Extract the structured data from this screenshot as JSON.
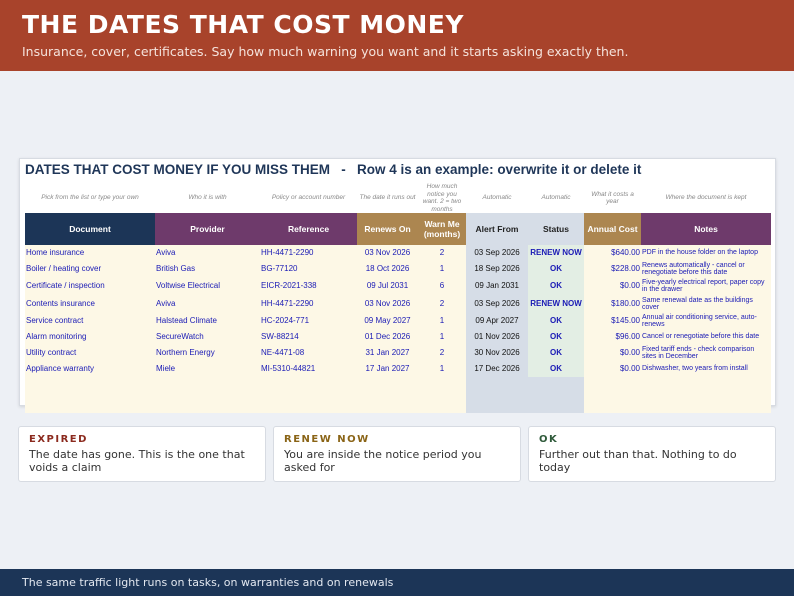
{
  "banner": {
    "title": "THE DATES THAT COST MONEY",
    "subtitle": "Insurance, cover, certificates. Say how much warning you want and it starts asking exactly then."
  },
  "sheet": {
    "title": "DATES THAT COST MONEY IF YOU MISS THEM   -   Row 4 is an example: overwrite it or delete it",
    "hints": {
      "document": "Pick from the list or type your own",
      "provider": "Who it is with",
      "reference": "Policy or account number",
      "renews_on": "The date it runs out",
      "warn_me": "How much notice you want. 2 = two months",
      "alert_from": "Automatic",
      "status": "Automatic",
      "annual_cost": "What it costs a year",
      "notes": "Where the document is kept"
    },
    "headers": {
      "document": "Document",
      "provider": "Provider",
      "reference": "Reference",
      "renews_on": "Renews On",
      "warn_me_line1": "Warn Me",
      "warn_me_line2": "(months)",
      "alert_from": "Alert From",
      "status": "Status",
      "annual_cost": "Annual Cost",
      "notes": "Notes"
    },
    "rows": [
      {
        "document": "Home insurance",
        "provider": "Aviva",
        "reference": "HH-4471-2290",
        "renews_on": "03 Nov 2026",
        "warn_me": "2",
        "alert_from": "03 Sep 2026",
        "status": "RENEW NOW",
        "annual_cost": "$640.00",
        "notes": "PDF in the house folder on the laptop"
      },
      {
        "document": "Boiler / heating cover",
        "provider": "British Gas",
        "reference": "BG-77120",
        "renews_on": "18 Oct 2026",
        "warn_me": "1",
        "alert_from": "18 Sep 2026",
        "status": "OK",
        "annual_cost": "$228.00",
        "notes": "Renews automatically - cancel or renegotiate before this date"
      },
      {
        "document": "Certificate / inspection",
        "provider": "Voltwise Electrical",
        "reference": "EICR-2021-338",
        "renews_on": "09 Jul 2031",
        "warn_me": "6",
        "alert_from": "09 Jan 2031",
        "status": "OK",
        "annual_cost": "$0.00",
        "notes": "Five-yearly electrical report, paper copy in the drawer"
      },
      {
        "document": "Contents insurance",
        "provider": "Aviva",
        "reference": "HH-4471-2290",
        "renews_on": "03 Nov 2026",
        "warn_me": "2",
        "alert_from": "03 Sep 2026",
        "status": "RENEW NOW",
        "annual_cost": "$180.00",
        "notes": "Same renewal date as the buildings cover"
      },
      {
        "document": "Service contract",
        "provider": "Halstead Climate",
        "reference": "HC-2024-771",
        "renews_on": "09 May 2027",
        "warn_me": "1",
        "alert_from": "09 Apr 2027",
        "status": "OK",
        "annual_cost": "$145.00",
        "notes": "Annual air conditioning service, auto-renews"
      },
      {
        "document": "Alarm monitoring",
        "provider": "SecureWatch",
        "reference": "SW-88214",
        "renews_on": "01 Dec 2026",
        "warn_me": "1",
        "alert_from": "01 Nov 2026",
        "status": "OK",
        "annual_cost": "$96.00",
        "notes": "Cancel or renegotiate before this date"
      },
      {
        "document": "Utility contract",
        "provider": "Northern Energy",
        "reference": "NE-4471-08",
        "renews_on": "31 Jan 2027",
        "warn_me": "2",
        "alert_from": "30 Nov 2026",
        "status": "OK",
        "annual_cost": "$0.00",
        "notes": "Fixed tariff ends - check comparison sites in December"
      },
      {
        "document": "Appliance warranty",
        "provider": "Miele",
        "reference": "MI-5310-44821",
        "renews_on": "17 Jan 2027",
        "warn_me": "1",
        "alert_from": "17 Dec 2026",
        "status": "OK",
        "annual_cost": "$0.00",
        "notes": "Dishwasher, two years from install"
      }
    ]
  },
  "legend": {
    "expired": {
      "label": "EXPIRED",
      "desc": "The date has gone. This is the one that voids a claim",
      "color": "#8b2a1e"
    },
    "renew_now": {
      "label": "RENEW NOW",
      "desc": "You are inside the notice period you asked for",
      "color": "#8a6416"
    },
    "ok": {
      "label": "OK",
      "desc": "Further out than that. Nothing to do today",
      "color": "#2f5a3a"
    }
  },
  "footer": {
    "text": "The same traffic light runs on tasks, on warranties and on renewals"
  },
  "colors": {
    "banner": "#a8432b",
    "navy": "#1c3557",
    "plum": "#6e3a6b",
    "tan": "#ac8650",
    "status_ok": "#3a7a44",
    "status_renew": "#b07d18"
  }
}
